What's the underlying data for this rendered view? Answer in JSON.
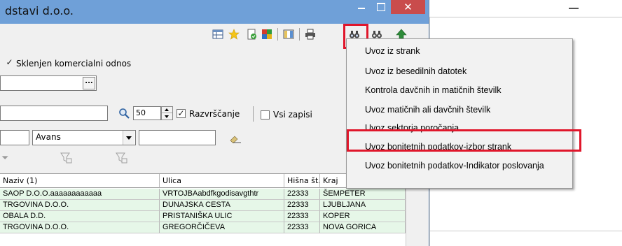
{
  "window": {
    "title": "dstavi  d.o.o.",
    "close_label": "✕"
  },
  "form": {
    "commercial_relation_label": "Sklenjen komercialni odnos",
    "commercial_relation_checked": "✓",
    "dots_label": "...",
    "limit_value": "50",
    "sort_label": "Razvrščanje",
    "sort_checked": "✓",
    "all_records_label": "Vsi zapisi",
    "combo_value": "Avans"
  },
  "grid": {
    "headers": [
      "Naziv (1)",
      "Ulica",
      "Hišna št.",
      "Kraj"
    ],
    "rows": [
      [
        "SAOP D.O.O.aaaaaaaaaaaa",
        "VRTOJBAabdfkgodisavgthtr",
        "22333",
        "ŠEMPETER"
      ],
      [
        "TRGOVINA D.O.O.",
        "DUNAJSKA CESTA",
        "22333",
        "LJUBLJANA"
      ],
      [
        "OBALA D.D.",
        "PRISTANIŠKA ULIC",
        "22333",
        "KOPER"
      ],
      [
        "TRGOVINA D.O.O.",
        "GREGORČIČEVA",
        "22333",
        "NOVA GORICA"
      ]
    ]
  },
  "menu": {
    "items": [
      "Uvoz iz strank",
      "Uvoz iz besedilnih datotek",
      "Kontrola davčnih in matičnih številk",
      "Uvoz matičnih ali davčnih številk",
      "Uvoz sektorja poročanja",
      "Uvoz bonitetnih podatkov-izbor strank",
      "Uvoz bonitetnih podatkov-Indikator poslovanja"
    ]
  },
  "toolbar": {
    "icons": [
      "table-icon",
      "star-icon",
      "document-icon",
      "grid-color-icon",
      "columns-icon",
      "printer-icon",
      "binoculars-import-icon",
      "binoculars-icon",
      "arrow-up-icon"
    ]
  }
}
